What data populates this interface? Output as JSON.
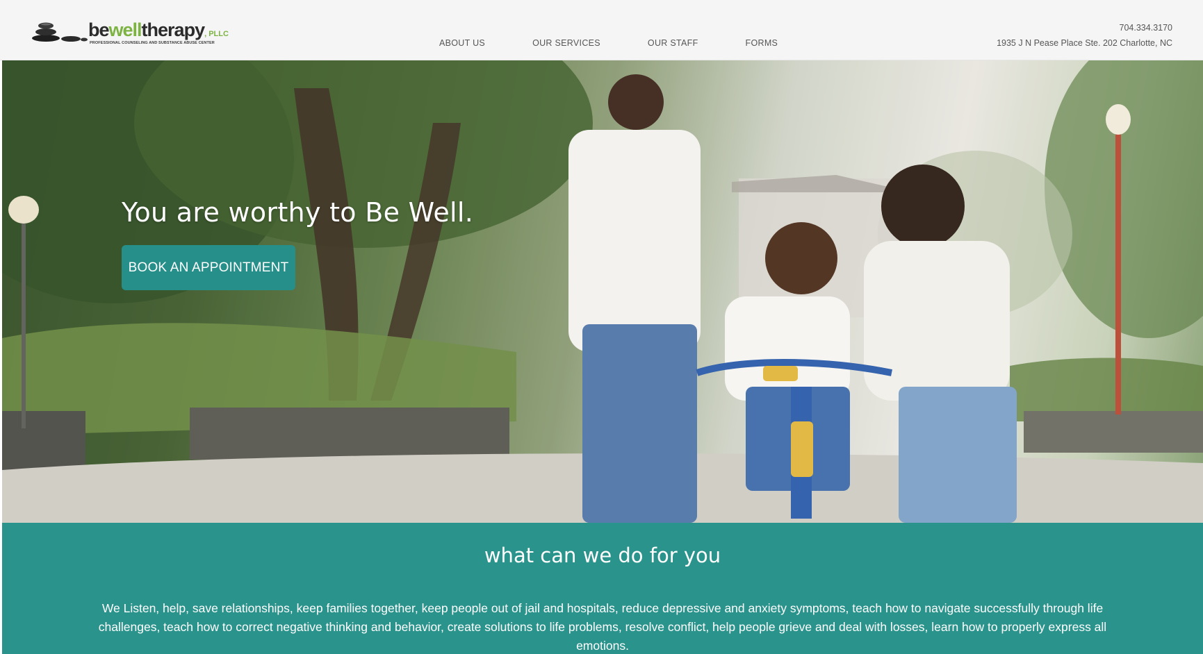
{
  "header": {
    "logo": {
      "name_be": "be",
      "name_well": "well",
      "name_therapy": "therapy",
      "suffix": ", PLLC",
      "tagline": "PROFESSIONAL COUNSELING AND SUBSTANCE ABUSE CENTER",
      "icon": "stacked-stones-icon"
    },
    "nav": [
      {
        "label": "ABOUT US"
      },
      {
        "label": "OUR SERVICES"
      },
      {
        "label": "OUR STAFF"
      },
      {
        "label": "FORMS"
      }
    ],
    "contact": {
      "phone": "704.334.3170",
      "address": "1935 J N Pease Place Ste. 202 Charlotte, NC"
    }
  },
  "hero": {
    "title": "You are worthy to Be Well.",
    "cta_label": "BOOK AN APPOINTMENT",
    "image": "family-teaching-child-to-ride-bicycle-in-park"
  },
  "section": {
    "title": "what can we do for you",
    "body": "We Listen, help, save relationships, keep families together, keep people out of jail and hospitals, reduce depressive and anxiety symptoms, teach how to navigate successfully through life challenges, teach how to correct negative thinking and behavior, create solutions to life problems, resolve conflict, help people grieve and deal with losses, learn how to properly express all emotions."
  },
  "colors": {
    "accent": "#2a938c",
    "button": "#268f8a",
    "logo_green": "#7cb342",
    "header_bg": "#f5f5f5",
    "nav_text": "#555555"
  }
}
